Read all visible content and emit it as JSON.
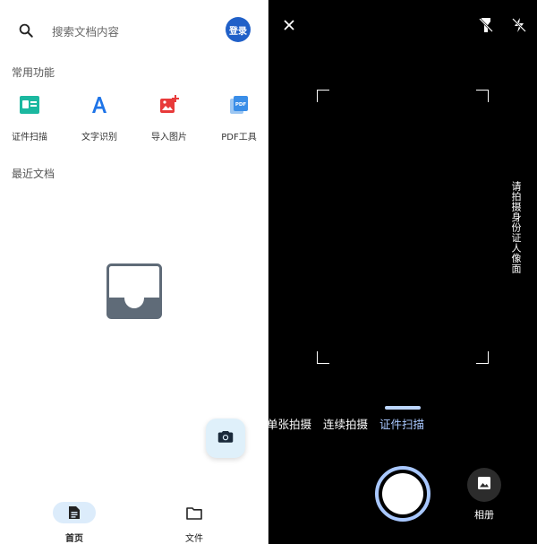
{
  "home": {
    "search": {
      "placeholder": "搜索文档内容",
      "icon": "search-icon"
    },
    "login_label": "登录",
    "common_section_title": "常用功能",
    "functions": [
      {
        "label": "证件扫描",
        "icon": "id-card-icon",
        "color": "#1bb8a0"
      },
      {
        "label": "文字识别",
        "icon": "text-a-icon",
        "color": "#1e74e8"
      },
      {
        "label": "导入图片",
        "icon": "image-add-icon",
        "color": "#e83a3a"
      },
      {
        "label": "PDF工具",
        "icon": "pdf-icon",
        "color": "#3a8ee8"
      }
    ],
    "recent_section_title": "最近文档",
    "fab_icon": "camera-icon",
    "nav": [
      {
        "label": "首页",
        "icon": "document-icon",
        "active": true
      },
      {
        "label": "文件",
        "icon": "folder-icon",
        "active": false
      }
    ]
  },
  "camera": {
    "close_icon": "close-icon",
    "flash_icon": "flashlight-off-icon",
    "flash_auto_icon": "flash-off-icon",
    "hint": "请拍摄身份证人像面",
    "modes": [
      {
        "label": "单张拍摄",
        "active": false
      },
      {
        "label": "连续拍摄",
        "active": false
      },
      {
        "label": "证件扫描",
        "active": true
      }
    ],
    "album_label": "相册",
    "accent": "#a9c8ff"
  }
}
